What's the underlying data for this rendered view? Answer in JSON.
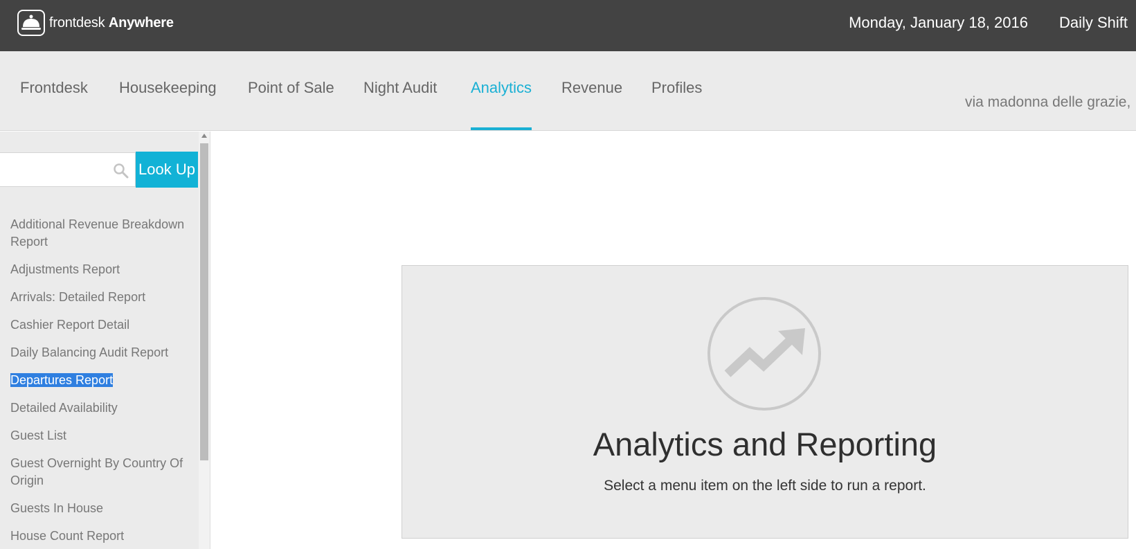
{
  "header": {
    "brand_light": "frontdesk",
    "brand_bold": "Anywhere",
    "date": "Monday, January 18, 2016",
    "shift": "Daily Shift"
  },
  "nav": {
    "tabs": [
      {
        "label": "Frontdesk",
        "active": false
      },
      {
        "label": "Housekeeping",
        "active": false
      },
      {
        "label": "Point of Sale",
        "active": false
      },
      {
        "label": "Night Audit",
        "active": false
      },
      {
        "label": "Analytics",
        "active": true
      },
      {
        "label": "Revenue",
        "active": false
      },
      {
        "label": "Profiles",
        "active": false
      }
    ],
    "address": "via madonna delle grazie,"
  },
  "sidebar": {
    "search_value": "",
    "lookup_label": "Look Up",
    "reports": [
      "Additional Revenue Breakdown Report",
      "Adjustments Report",
      "Arrivals: Detailed Report",
      "Cashier Report Detail",
      "Daily Balancing Audit Report",
      "Departures Report",
      "Detailed Availability",
      "Guest List",
      "Guest Overnight By Country Of Origin",
      "Guests In House",
      "House Count Report"
    ],
    "selected": "Departures Report"
  },
  "panel": {
    "title": "Analytics and Reporting",
    "subtitle": "Select a menu item on the left side to run a report."
  },
  "colors": {
    "accent": "#1ab0d4",
    "topbar": "#434343",
    "selection": "#2f7fe0"
  }
}
